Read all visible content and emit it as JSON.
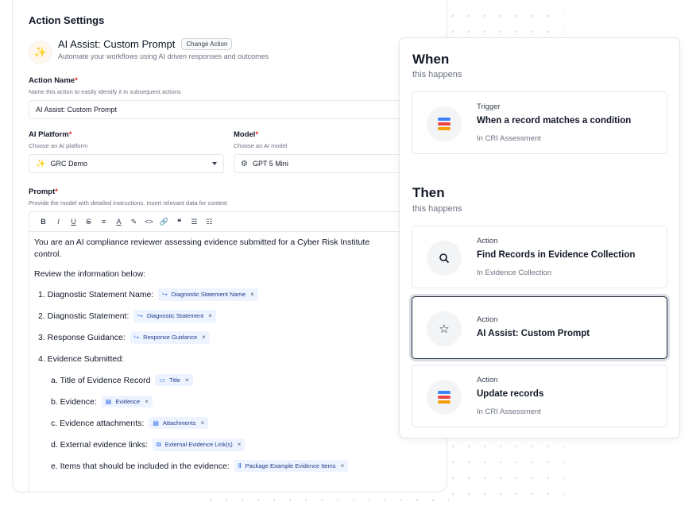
{
  "action_settings": {
    "title": "Action Settings",
    "ai_header": {
      "title": "AI Assist: Custom Prompt",
      "change_button": "Change Action",
      "subtitle": "Automate your workflows using AI driven responses and outcomes",
      "icon": "sparkle-icon"
    },
    "action_name": {
      "label": "Action Name",
      "hint": "Name this action to easily identify it in subsequent actions",
      "value": "AI Assist: Custom Prompt"
    },
    "ai_platform": {
      "label": "AI Platform",
      "hint": "Choose an AI platform",
      "value": "GRC Demo"
    },
    "model": {
      "label": "Model",
      "hint": "Choose an AI model",
      "value": "GPT 5 Mini"
    },
    "prompt": {
      "label": "Prompt",
      "hint": "Provide the model with detailed instructions. Insert relevant data for context",
      "toolbar": [
        "B",
        "I",
        "U",
        "S",
        "≡",
        "A",
        "✎",
        "<>",
        "🔗",
        "❝",
        "☰",
        "☷"
      ],
      "intro_line1": "You are an AI compliance reviewer assessing evidence submitted for a Cyber Risk Institute",
      "intro_line2": "control.",
      "review_line": "Review the information below:",
      "items": [
        {
          "text": "1. Diagnostic Statement Name:",
          "chip": "Diagnostic Statement Name"
        },
        {
          "text": "2. Diagnostic Statement:",
          "chip": "Diagnostic Statement"
        },
        {
          "text": "3. Response Guidance:",
          "chip": "Response Guidance"
        },
        {
          "text": "4. Evidence Submitted:",
          "chip": ""
        }
      ],
      "subitems": [
        {
          "text": "a. Title of Evidence Record",
          "chip": "Title"
        },
        {
          "text": "b. Evidence:",
          "chip": "Evidence"
        },
        {
          "text": "c. Evidence attachments:",
          "chip": "Attachments"
        },
        {
          "text": "d. External evidence links:",
          "chip": "External Evidence Link(s)"
        },
        {
          "text": "e. Items that should be included in the evidence:",
          "chip": "Package Example Evidence Items"
        }
      ]
    }
  },
  "workflow": {
    "when": {
      "title": "When",
      "subtitle": "this happens"
    },
    "then": {
      "title": "Then",
      "subtitle": "this happens"
    },
    "trigger": {
      "kind": "Trigger",
      "title": "When a record matches a condition",
      "sub": "In CRI Assessment"
    },
    "actions": [
      {
        "kind": "Action",
        "title": "Find Records in Evidence Collection",
        "sub": "In Evidence Collection"
      },
      {
        "kind": "Action",
        "title": "AI Assist: Custom Prompt",
        "sub": ""
      },
      {
        "kind": "Action",
        "title": "Update records",
        "sub": "In CRI Assessment"
      }
    ]
  },
  "colors": {
    "brand_stack": [
      "#3b82f6",
      "#ef4444",
      "#f59e0b"
    ],
    "required": "#dc2626",
    "chip_bg": "#eef4ff"
  }
}
